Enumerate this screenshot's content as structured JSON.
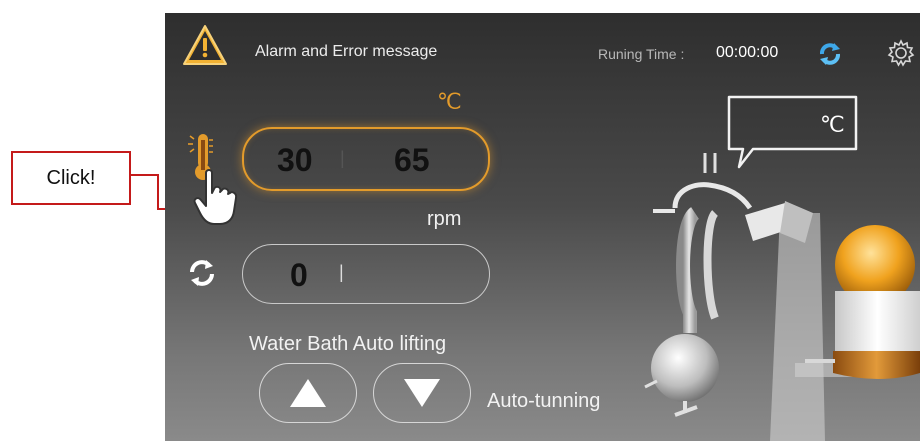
{
  "annotation": {
    "label": "Click!",
    "color": "#c41a1a"
  },
  "header": {
    "alarm_text": "Alarm and Error message",
    "running_label": "Runing Time :",
    "running_value": "00:00:00"
  },
  "temperature": {
    "unit": "℃",
    "set_value": "30",
    "separator": "|",
    "actual_value": "65",
    "accent_color": "#e39b2b"
  },
  "rotation": {
    "unit": "rpm",
    "set_value": "0",
    "separator": "|",
    "actual_value": ""
  },
  "water_bath": {
    "label": "Water Bath Auto lifting",
    "auto_tuning_label": "Auto-tunning"
  },
  "display_bubble": {
    "value": "",
    "unit": "℃"
  },
  "icons": [
    "warning-icon",
    "refresh-icon",
    "gear-icon",
    "thermometer-icon",
    "hand-pointer-icon",
    "rotate-icon",
    "up-arrow-icon",
    "down-arrow-icon"
  ]
}
